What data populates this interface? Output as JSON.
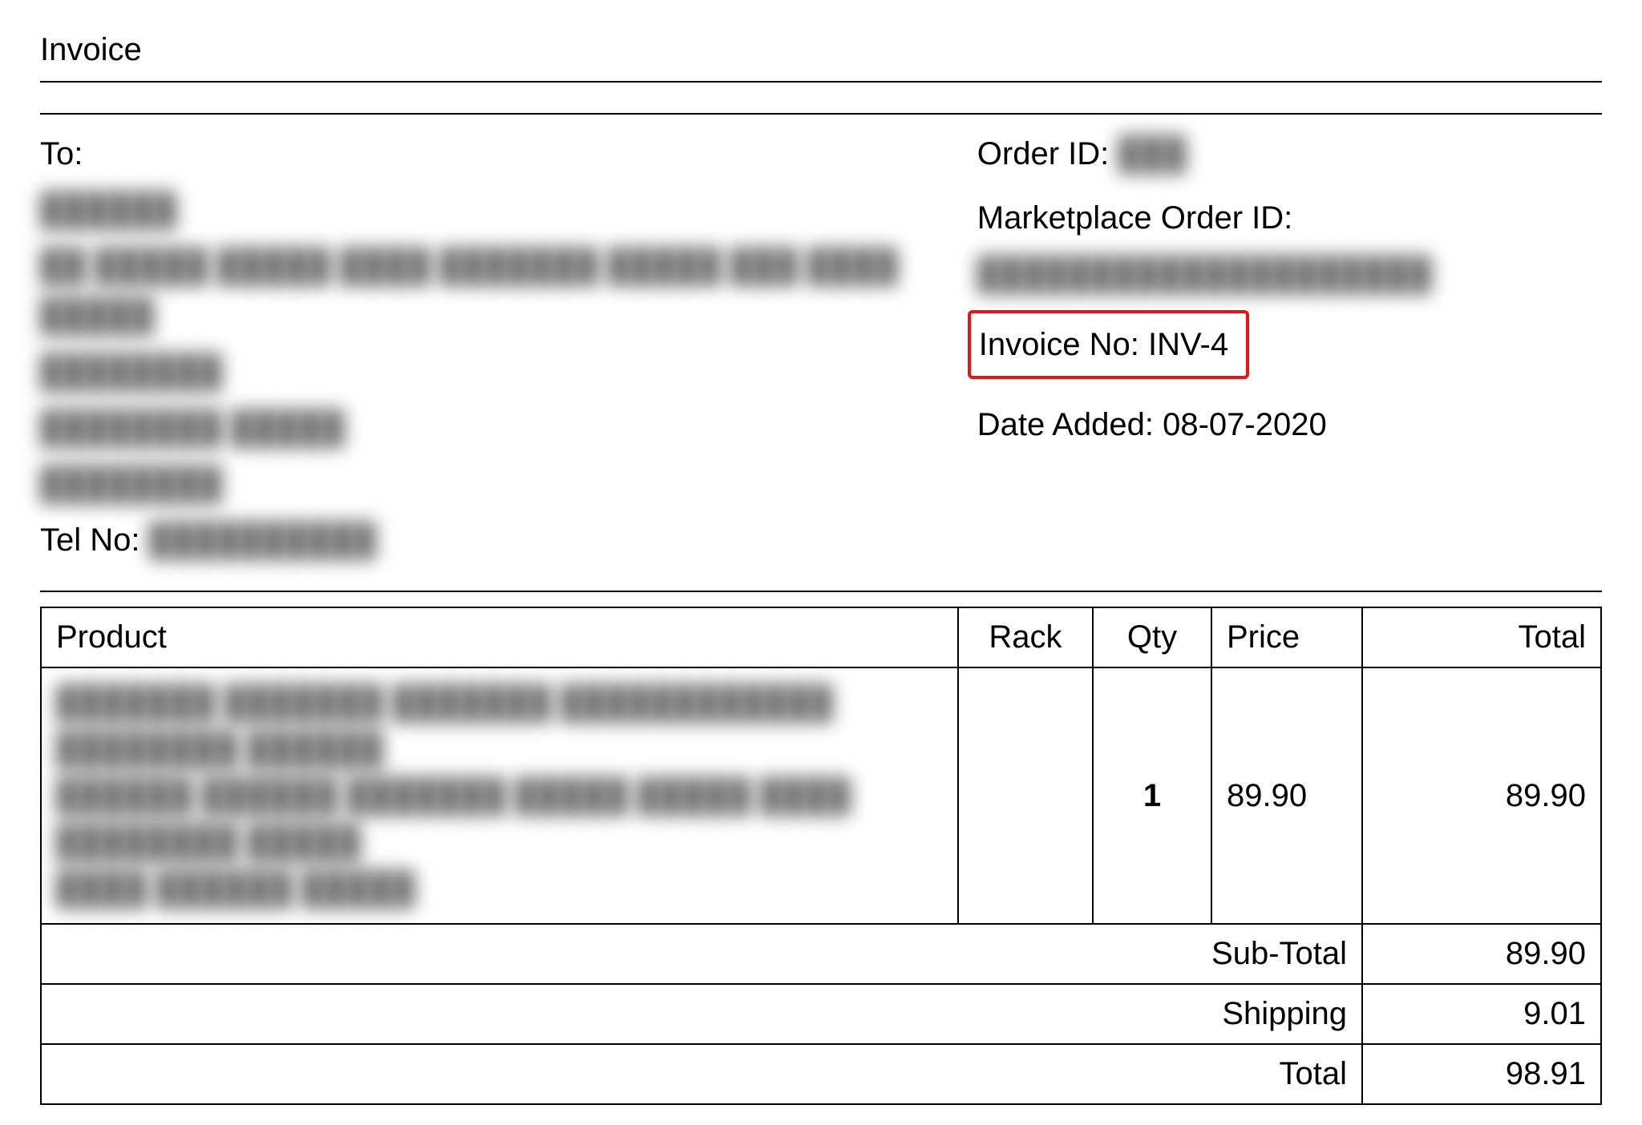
{
  "title": "Invoice",
  "to": {
    "label": "To:",
    "name_redacted": "██████",
    "address_lines_redacted": [
      "██  █████ █████ ████ ███████   █████ ███ ████   █████",
      "████████",
      "████████  █████",
      "████████"
    ],
    "tel_label": "Tel No:",
    "tel_redacted": "██████████"
  },
  "order": {
    "order_id_label": "Order ID:",
    "order_id_redacted": "███",
    "marketplace_label": "Marketplace Order ID:",
    "marketplace_redacted": "████████████████████",
    "invoice_no_label": "Invoice No:",
    "invoice_no_value": "INV-4",
    "date_added_label": "Date Added:",
    "date_added_value": "08-07-2020"
  },
  "table": {
    "headers": {
      "product": "Product",
      "rack": "Rack",
      "qty": "Qty",
      "price": "Price",
      "total": "Total"
    },
    "rows": [
      {
        "product_redacted_lines": [
          "███████  ███████  ███████   ████████████ ████████ ██████",
          "██████ ██████ ███████ █████ █████ ████",
          "████████ █████",
          "████ ██████ █████"
        ],
        "rack": "",
        "qty": "1",
        "price": "89.90",
        "total": "89.90"
      }
    ],
    "summary": {
      "subtotal_label": "Sub-Total",
      "subtotal_value": "89.90",
      "shipping_label": "Shipping",
      "shipping_value": "9.01",
      "total_label": "Total",
      "total_value": "98.91"
    }
  }
}
